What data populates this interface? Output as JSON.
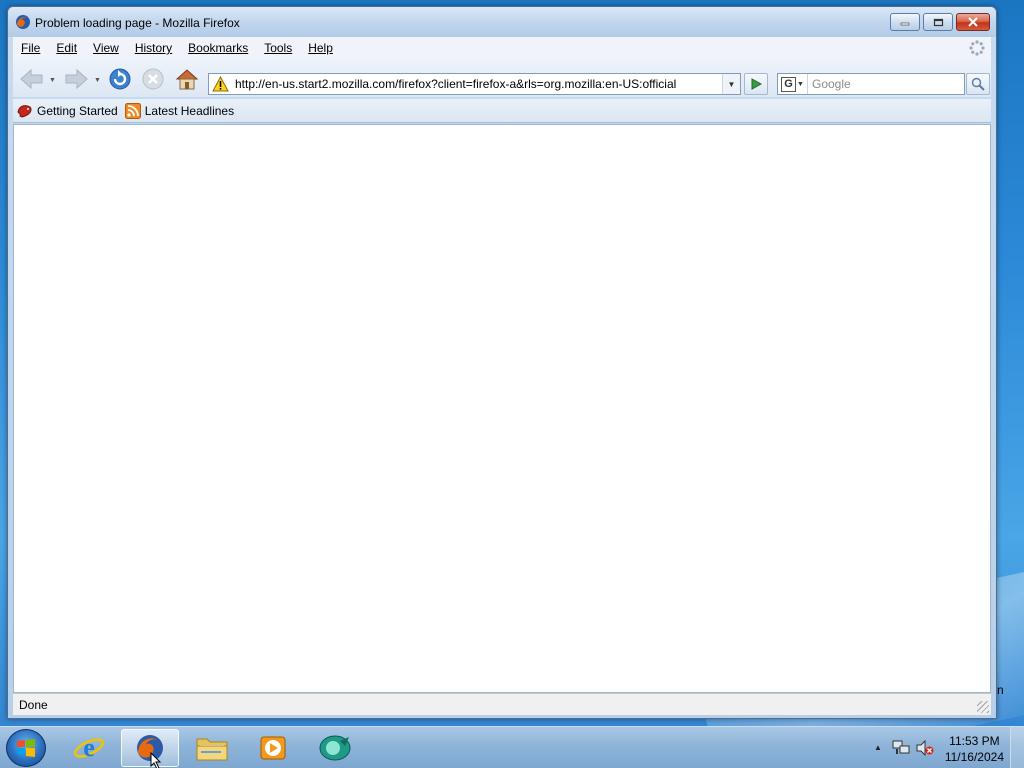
{
  "window": {
    "title": "Problem loading page - Mozilla Firefox"
  },
  "menu": {
    "items": [
      {
        "label": "File"
      },
      {
        "label": "Edit"
      },
      {
        "label": "View"
      },
      {
        "label": "History"
      },
      {
        "label": "Bookmarks"
      },
      {
        "label": "Tools"
      },
      {
        "label": "Help"
      }
    ]
  },
  "navigation": {
    "url": "http://en-us.start2.mozilla.com/firefox?client=firefox-a&rls=org.mozilla:en-US:official",
    "search_placeholder": "Google",
    "search_engine": "G"
  },
  "bookmarks": {
    "items": [
      {
        "label": "Getting Started",
        "icon": "firefox-getting-started-icon"
      },
      {
        "label": "Latest Headlines",
        "icon": "rss-feed-icon"
      }
    ]
  },
  "status": {
    "text": "Done"
  },
  "taskbar": {
    "pinned": [
      {
        "name": "internet-explorer"
      },
      {
        "name": "firefox",
        "active": true
      },
      {
        "name": "windows-explorer"
      },
      {
        "name": "windows-media-player"
      },
      {
        "name": "app"
      }
    ],
    "clock": {
      "time": "11:53 PM",
      "date": "11/16/2024"
    }
  },
  "desktop": {
    "edge_letter": "n"
  },
  "colors": {
    "titlebar": "#c1d6ee",
    "close_button": "#c2321a",
    "desktop": "#2d8ad8",
    "taskbar": "#8fb4d9"
  }
}
